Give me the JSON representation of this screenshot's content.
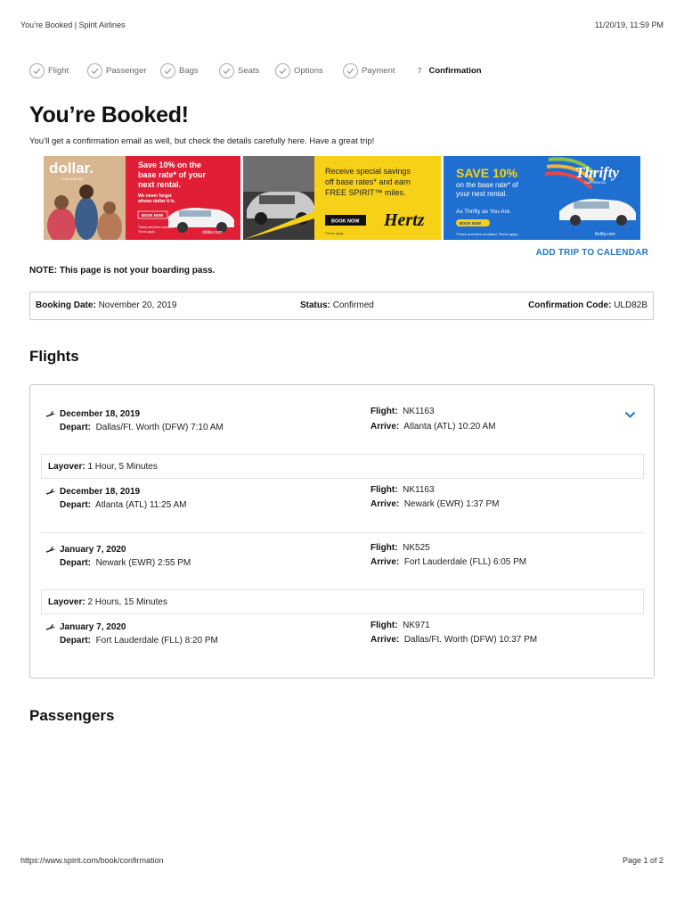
{
  "print_header": {
    "page_title": "You’re Booked | Spirit Airlines",
    "datetime": "11/20/19, 11:59 PM"
  },
  "steps": [
    {
      "label": "Flight",
      "state": "done"
    },
    {
      "label": "Passenger",
      "state": "done"
    },
    {
      "label": "Bags",
      "state": "done"
    },
    {
      "label": "Seats",
      "state": "done"
    },
    {
      "label": "Options",
      "state": "done"
    },
    {
      "label": "Payment",
      "state": "done"
    },
    {
      "number": "7",
      "label": "Confirmation",
      "state": "active"
    }
  ],
  "heading": "You’re Booked!",
  "subheading": "You’ll get a confirmation email as well, but check the details carefully here.  Have a great trip!",
  "ads": {
    "dollar": {
      "logo": "dollar.",
      "logo_sub": "CAR RENTAL",
      "headline": [
        "Save 10% on the",
        "base rate* of your",
        "next rental."
      ],
      "tagline": [
        "We never forget",
        "whose dollar it is."
      ],
      "button": "BOOK NOW",
      "fine_print": [
        "*Taxes and fees excluded.",
        "Terms apply."
      ],
      "url": "dollar.com"
    },
    "hertz": {
      "headline": [
        "Receive special savings",
        "off base rates* and earn",
        "FREE SPIRIT™ miles."
      ],
      "button": "BOOK NOW",
      "fine_print": "*Terms apply.",
      "logo": "Hertz"
    },
    "thrifty": {
      "headline": "SAVE 10%",
      "sub": [
        "on the base rate* of",
        "your next rental."
      ],
      "tagline": "As Thrifty as You Are.",
      "button": "BOOK NOW",
      "fine_print": "*Taxes and fees excluded. Terms apply.",
      "url": "thrifty.com",
      "logo": "Thrifty",
      "logo_sub": "CAR RENTAL"
    }
  },
  "add_to_calendar": "ADD TRIP TO CALENDAR",
  "note": "NOTE: This page is not your boarding pass.",
  "booking": {
    "date_label": "Booking Date:",
    "date_value": "November 20, 2019",
    "status_label": "Status:",
    "status_value": "Confirmed",
    "code_label": "Confirmation Code:",
    "code_value": "ULD82B"
  },
  "flights_heading": "Flights",
  "labels": {
    "depart": "Depart:",
    "flight": "Flight:",
    "arrive": "Arrive:",
    "layover": "Layover:"
  },
  "segments": [
    {
      "date": "December 18, 2019",
      "depart": "Dallas/Ft. Worth (DFW) 7:10 AM",
      "flight": "NK1163",
      "arrive": "Atlanta (ATL) 10:20 AM"
    },
    {
      "date": "December 18, 2019",
      "depart": "Atlanta (ATL) 11:25 AM",
      "flight": "NK1163",
      "arrive": "Newark (EWR) 1:37 PM"
    },
    {
      "date": "January 7, 2020",
      "depart": "Newark (EWR) 2:55 PM",
      "flight": "NK525",
      "arrive": "Fort Lauderdale (FLL) 6:05 PM"
    },
    {
      "date": "January 7, 2020",
      "depart": "Fort Lauderdale (FLL) 8:20 PM",
      "flight": "NK971",
      "arrive": "Dallas/Ft. Worth (DFW) 10:37 PM"
    }
  ],
  "layovers": [
    "1 Hour, 5 Minutes",
    "2 Hours, 15 Minutes"
  ],
  "passengers_heading": "Passengers",
  "print_footer": {
    "url": "https://www.spirit.com/book/confirmation",
    "page": "Page 1 of 2"
  },
  "colors": {
    "accent_blue": "#1f77c9",
    "dollar_red": "#e01f36",
    "hertz_yellow": "#f7d117",
    "thrifty_blue": "#1f6fd1"
  }
}
